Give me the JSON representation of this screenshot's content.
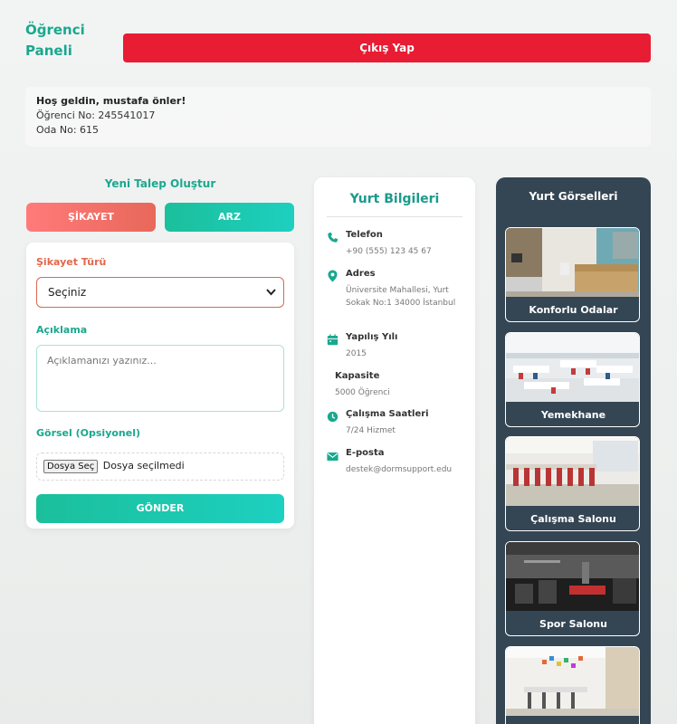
{
  "header": {
    "brand": "Öğrenci Paneli",
    "logout_label": "Çıkış Yap"
  },
  "welcome": {
    "greeting": "Hoş geldin, mustafa önler!",
    "student_no": "Öğrenci No: 245541017",
    "room_no": "Oda No: 615"
  },
  "request_form": {
    "title": "Yeni Talep Oluştur",
    "tab_complaint": "ŞİKAYET",
    "tab_request": "ARZ",
    "type_label": "Şikayet Türü",
    "type_value": "Seçiniz",
    "desc_label": "Açıklama",
    "desc_placeholder": "Açıklamanızı yazınız...",
    "image_label": "Görsel (Opsiyonel)",
    "file_button": "Dosya Seç",
    "file_status": "Dosya seçilmedi",
    "submit_label": "GÖNDER"
  },
  "dorm_info": {
    "title": "Yurt Bilgileri",
    "items": [
      {
        "key": "Telefon",
        "value": "+90 (555) 123 45 67",
        "icon": "phone-icon"
      },
      {
        "key": "Adres",
        "value": "Üniversite Mahallesi, Yurt Sokak No:1 34000 İstanbul",
        "icon": "location-pin-icon"
      },
      {
        "key": "Yapılış Yılı",
        "value": "2015",
        "icon": "calendar-icon"
      },
      {
        "key": "Kapasite",
        "value": "5000 Öğrenci",
        "icon": ""
      },
      {
        "key": "Çalışma Saatleri",
        "value": "7/24 Hizmet",
        "icon": "clock-icon"
      },
      {
        "key": "E-posta",
        "value": "destek@dormsupport.edu",
        "icon": "envelope-icon"
      }
    ]
  },
  "gallery": {
    "title": "Yurt Görselleri",
    "items": [
      {
        "caption": "Konforlu Odalar"
      },
      {
        "caption": "Yemekhane"
      },
      {
        "caption": "Çalışma Salonu"
      },
      {
        "caption": "Spor Salonu"
      },
      {
        "caption": ""
      }
    ]
  },
  "colors": {
    "accent": "#1aa88e",
    "danger": "#e81c33",
    "gallery_bg": "#344553"
  }
}
